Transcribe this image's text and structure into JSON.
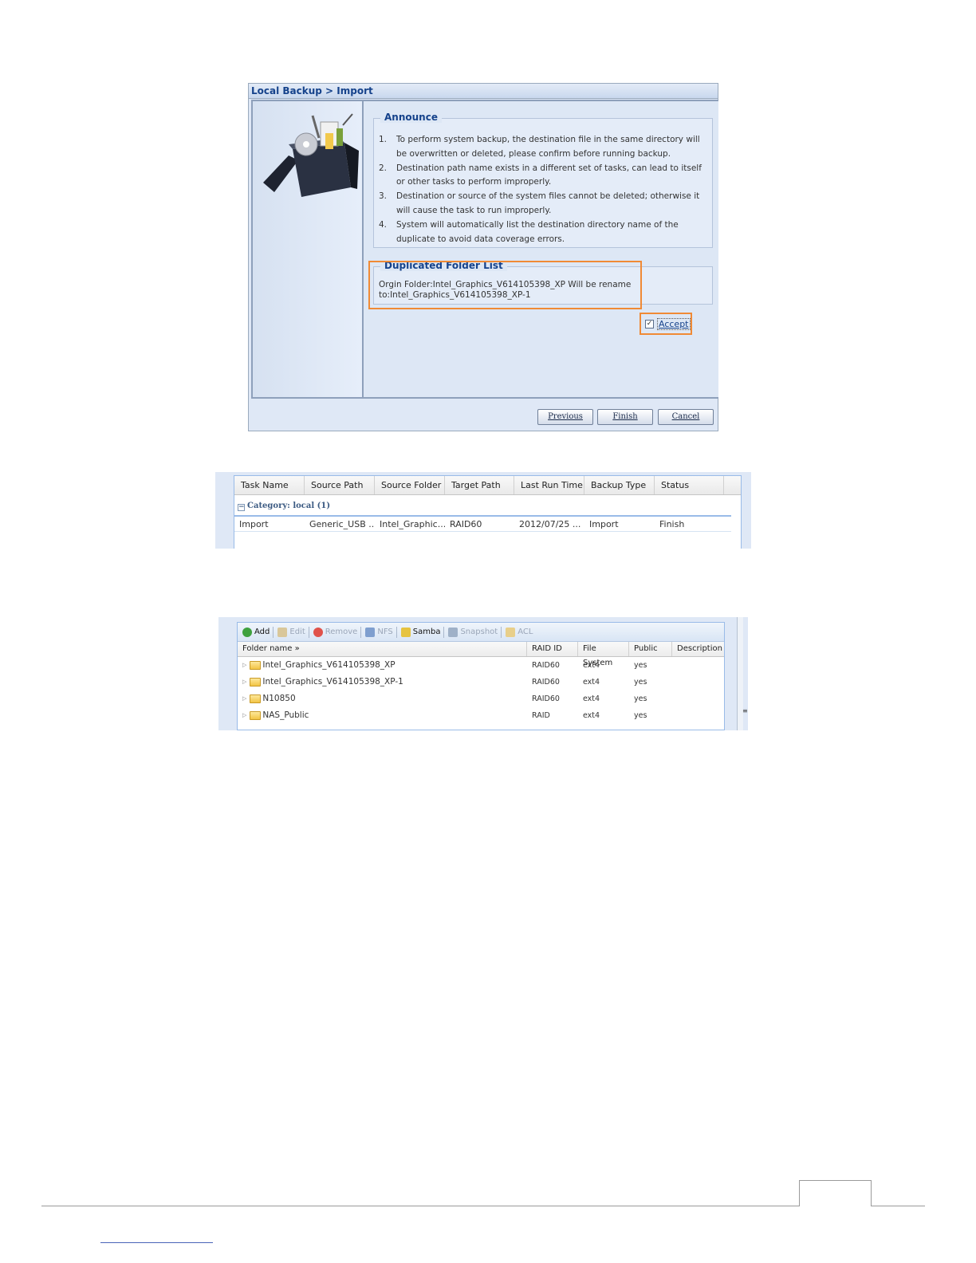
{
  "wizard": {
    "title": "Local Backup > Import",
    "announce": {
      "legend": "Announce",
      "items": [
        {
          "num": "1.",
          "text": "To perform system backup, the destination file in the same directory will be overwritten or deleted, please confirm before running backup."
        },
        {
          "num": "2.",
          "text": "Destination path name exists in a different set of tasks, can lead to itself or other tasks to perform improperly."
        },
        {
          "num": "3.",
          "text": "Destination or source of the system files cannot be deleted; otherwise it will cause the task to run improperly."
        },
        {
          "num": "4.",
          "text": "System will automatically list the destination directory name of the duplicate to avoid data coverage errors."
        }
      ]
    },
    "duplicated": {
      "legend": "Duplicated Folder List",
      "text": "Orgin Folder:Intel_Graphics_V614105398_XP Will be rename to:Intel_Graphics_V614105398_XP-1"
    },
    "accept": {
      "label": "Accept",
      "checked": true,
      "mark": "✓"
    },
    "buttons": {
      "previous": "Previous",
      "finish": "Finish",
      "cancel": "Cancel"
    },
    "highlight_color": "#f08a35"
  },
  "task_grid": {
    "columns": [
      "Task Name",
      "Source Path",
      "Source Folder",
      "Target Path",
      "Last Run Time",
      "Backup Type",
      "Status"
    ],
    "category": {
      "toggle": "−",
      "label": "Category: local (1)"
    },
    "rows": [
      {
        "task_name": "Import",
        "source_path": "Generic_USB ...",
        "source_folder": "Intel_Graphic...",
        "target_path": "RAID60",
        "last_run": "2012/07/25 ...",
        "backup_type": "Import",
        "status": "Finish"
      }
    ]
  },
  "share_folders": {
    "toolbar": [
      {
        "label": "Add",
        "icon": "add-icon",
        "enabled": true
      },
      {
        "label": "Edit",
        "icon": "edit-icon",
        "enabled": false
      },
      {
        "label": "Remove",
        "icon": "remove-icon",
        "enabled": false
      },
      {
        "label": "NFS",
        "icon": "nfs-icon",
        "enabled": false
      },
      {
        "label": "Samba",
        "icon": "samba-icon",
        "enabled": true
      },
      {
        "label": "Snapshot",
        "icon": "snapshot-icon",
        "enabled": false
      },
      {
        "label": "ACL",
        "icon": "acl-icon",
        "enabled": false
      }
    ],
    "columns": [
      "Folder name »",
      "RAID ID",
      "File System",
      "Public",
      "Description"
    ],
    "rows": [
      {
        "name": "Intel_Graphics_V614105398_XP",
        "raid": "RAID60",
        "fs": "ext4",
        "public": "yes"
      },
      {
        "name": "Intel_Graphics_V614105398_XP-1",
        "raid": "RAID60",
        "fs": "ext4",
        "public": "yes"
      },
      {
        "name": "N10850",
        "raid": "RAID60",
        "fs": "ext4",
        "public": "yes"
      },
      {
        "name": "NAS_Public",
        "raid": "RAID",
        "fs": "ext4",
        "public": "yes"
      }
    ]
  }
}
